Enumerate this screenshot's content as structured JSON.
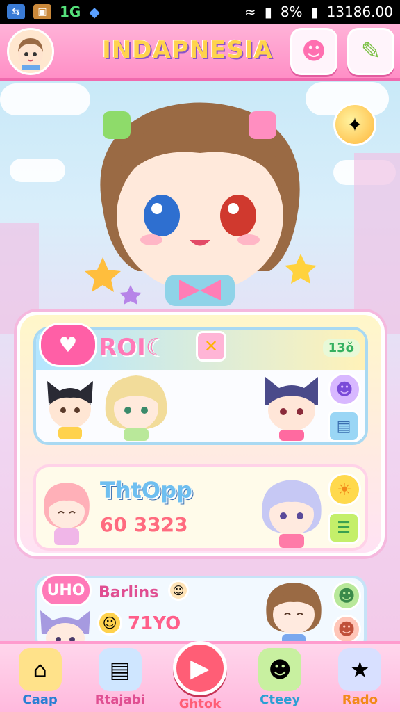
{
  "status_bar": {
    "app_icon_1": "⇆",
    "app_icon_2": "▣",
    "network_label": "1G",
    "battery_percent": "8%",
    "time": "13186.00"
  },
  "header": {
    "title": "INDAPNESIA",
    "button_1_icon": "face-bubble-icon",
    "button_2_icon": "pencil-icon"
  },
  "panel_roll": {
    "title": "ROI☾",
    "tag": "13ǒ"
  },
  "panel_top": {
    "title": "ThtOpp",
    "score": "60 3323"
  },
  "panel_bottom": {
    "badge": "UHO",
    "title": "Barlins",
    "value": "71YO"
  },
  "nav": [
    {
      "label": "Caap",
      "icon": "house-icon",
      "color": "#2a7fd4"
    },
    {
      "label": "Rtajabi",
      "icon": "book-icon",
      "color": "#e04f92"
    },
    {
      "label": "Ghtok",
      "icon": "play-icon",
      "color": "#ff5e76"
    },
    {
      "label": "Cteey",
      "icon": "monster-icon",
      "color": "#2a9fd4"
    },
    {
      "label": "Rado",
      "icon": "star-box-icon",
      "color": "#f28a1a"
    }
  ],
  "colors": {
    "header_pink": "#ff8fc6",
    "accent_yellow": "#ffd34d",
    "accent_blue": "#6fbff0"
  }
}
